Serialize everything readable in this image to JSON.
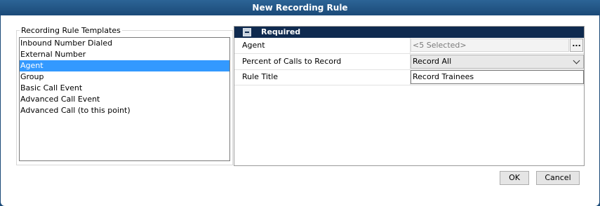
{
  "window": {
    "title": "New Recording Rule"
  },
  "templates": {
    "legend": "Recording Rule Templates",
    "items": [
      {
        "label": "Inbound Number Dialed",
        "selected": false
      },
      {
        "label": "External Number",
        "selected": false
      },
      {
        "label": "Agent",
        "selected": true
      },
      {
        "label": "Group",
        "selected": false
      },
      {
        "label": "Basic Call Event",
        "selected": false
      },
      {
        "label": "Advanced Call Event",
        "selected": false
      },
      {
        "label": "Advanced Call (to this point)",
        "selected": false
      }
    ]
  },
  "properties": {
    "section": "Required",
    "collapse_icon": "collapse-icon",
    "agent": {
      "label": "Agent",
      "value": "<5 Selected>",
      "button": "..."
    },
    "percent": {
      "label": "Percent of Calls to Record",
      "value": "Record All",
      "icon": "chevron-down-icon"
    },
    "rule_title": {
      "label": "Rule Title",
      "value": "Record Trainees"
    }
  },
  "buttons": {
    "ok": "OK",
    "cancel": "Cancel"
  },
  "colors": {
    "titlebar": "#1b4a78",
    "selection": "#3399ff",
    "section_header": "#0f2a4f"
  }
}
